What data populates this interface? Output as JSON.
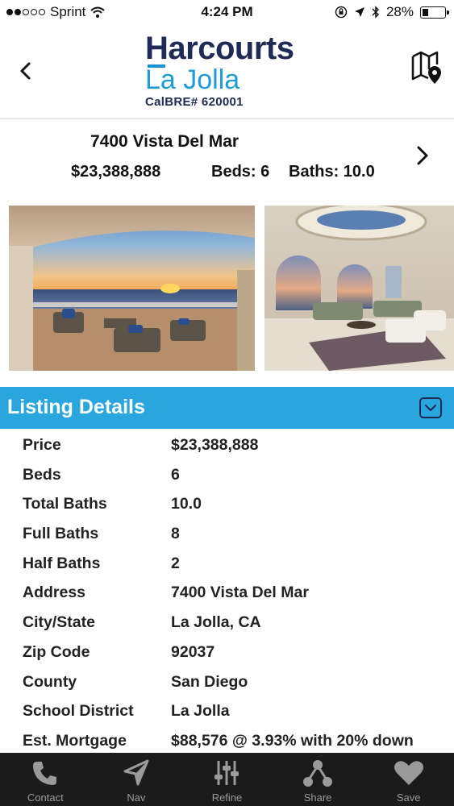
{
  "status_bar": {
    "carrier": "Sprint",
    "time": "4:24 PM",
    "battery": "28%",
    "battery_level": 0.28
  },
  "header": {
    "brand": "Harcourts",
    "city": "La Jolla",
    "license": "CalBRE# 620001",
    "back_icon": "chevron-left-icon",
    "map_icon": "map-pin-icon"
  },
  "summary": {
    "address": "7400 Vista Del Mar",
    "price": "$23,388,888",
    "beds": "Beds: 6",
    "baths": "Baths: 10.0"
  },
  "details": {
    "title": "Listing Details",
    "rows": [
      {
        "label": "Price",
        "value": "$23,388,888"
      },
      {
        "label": "Beds",
        "value": "6"
      },
      {
        "label": "Total Baths",
        "value": "10.0"
      },
      {
        "label": "Full Baths",
        "value": "8"
      },
      {
        "label": "Half Baths",
        "value": "2"
      },
      {
        "label": "Address",
        "value": "7400 Vista Del Mar"
      },
      {
        "label": "City/State",
        "value": "La Jolla, CA"
      },
      {
        "label": "Zip Code",
        "value": "92037"
      },
      {
        "label": "County",
        "value": "San Diego"
      },
      {
        "label": "School District",
        "value": "La Jolla"
      },
      {
        "label": "Est. Mortgage",
        "value": "$88,576 @ 3.93% with 20% down"
      }
    ]
  },
  "tabs": [
    {
      "label": "Contact",
      "icon": "phone-icon"
    },
    {
      "label": "Nav",
      "icon": "navigation-arrow-icon"
    },
    {
      "label": "Refine",
      "icon": "sliders-icon"
    },
    {
      "label": "Share",
      "icon": "share-icon"
    },
    {
      "label": "Save",
      "icon": "heart-icon"
    }
  ],
  "colors": {
    "accent": "#2aa6de",
    "brand_navy": "#1d2b55",
    "brand_blue": "#1f9bd8",
    "tab_bar": "#1b1b1b"
  }
}
